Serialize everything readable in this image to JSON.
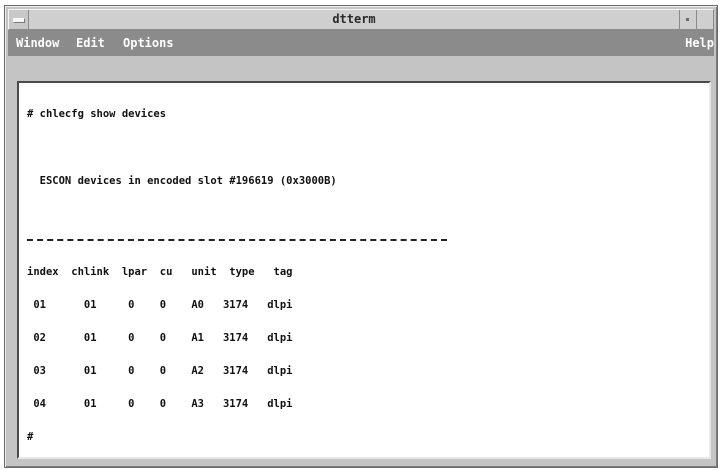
{
  "window": {
    "title": "dtterm"
  },
  "menubar": {
    "window_label": "Window",
    "edit_label": "Edit",
    "options_label": "Options",
    "help_label": "Help"
  },
  "terminal": {
    "command_line": "# chlecfg show devices",
    "heading_line": "  ESCON devices in encoded slot #196619 (0x3000B)",
    "header_line": "index  chlink  lpar  cu   unit  type   tag",
    "rows": [
      " 01      01     0    0    A0   3174   dlpi",
      " 02      01     0    0    A1   3174   dlpi",
      " 03      01     0    0    A2   3174   dlpi",
      " 04      01     0    0    A3   3174   dlpi"
    ],
    "prompt": "#"
  }
}
